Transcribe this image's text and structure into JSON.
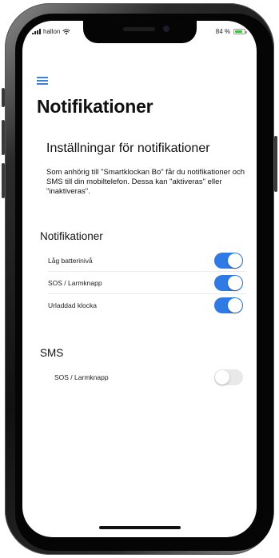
{
  "status_bar": {
    "carrier": "hallon",
    "battery_text": "84 %",
    "battery_level": 0.84,
    "battery_color": "#3ec23e"
  },
  "header": {
    "menu_icon": "hamburger-menu-icon",
    "title": "Notifikationer"
  },
  "settings": {
    "heading": "Inställningar för notifikationer",
    "description": "Som anhörig till \"Smartklockan Bo\" får du notifikationer och SMS till din mobiltelefon. Dessa kan \"aktiveras\" eller \"inaktiveras\"."
  },
  "notifications": {
    "title": "Notifikationer",
    "items": [
      {
        "label": "Låg batterinivå",
        "enabled": true
      },
      {
        "label": "SOS / Larmknapp",
        "enabled": true
      },
      {
        "label": "Urladdad klocka",
        "enabled": true
      }
    ]
  },
  "sms": {
    "title": "SMS",
    "items": [
      {
        "label": "SOS / Larmknapp",
        "enabled": false
      }
    ]
  },
  "colors": {
    "accent": "#2f7ae5",
    "menu": "#3b82d6",
    "toggle_off": "#e9e9ea"
  }
}
